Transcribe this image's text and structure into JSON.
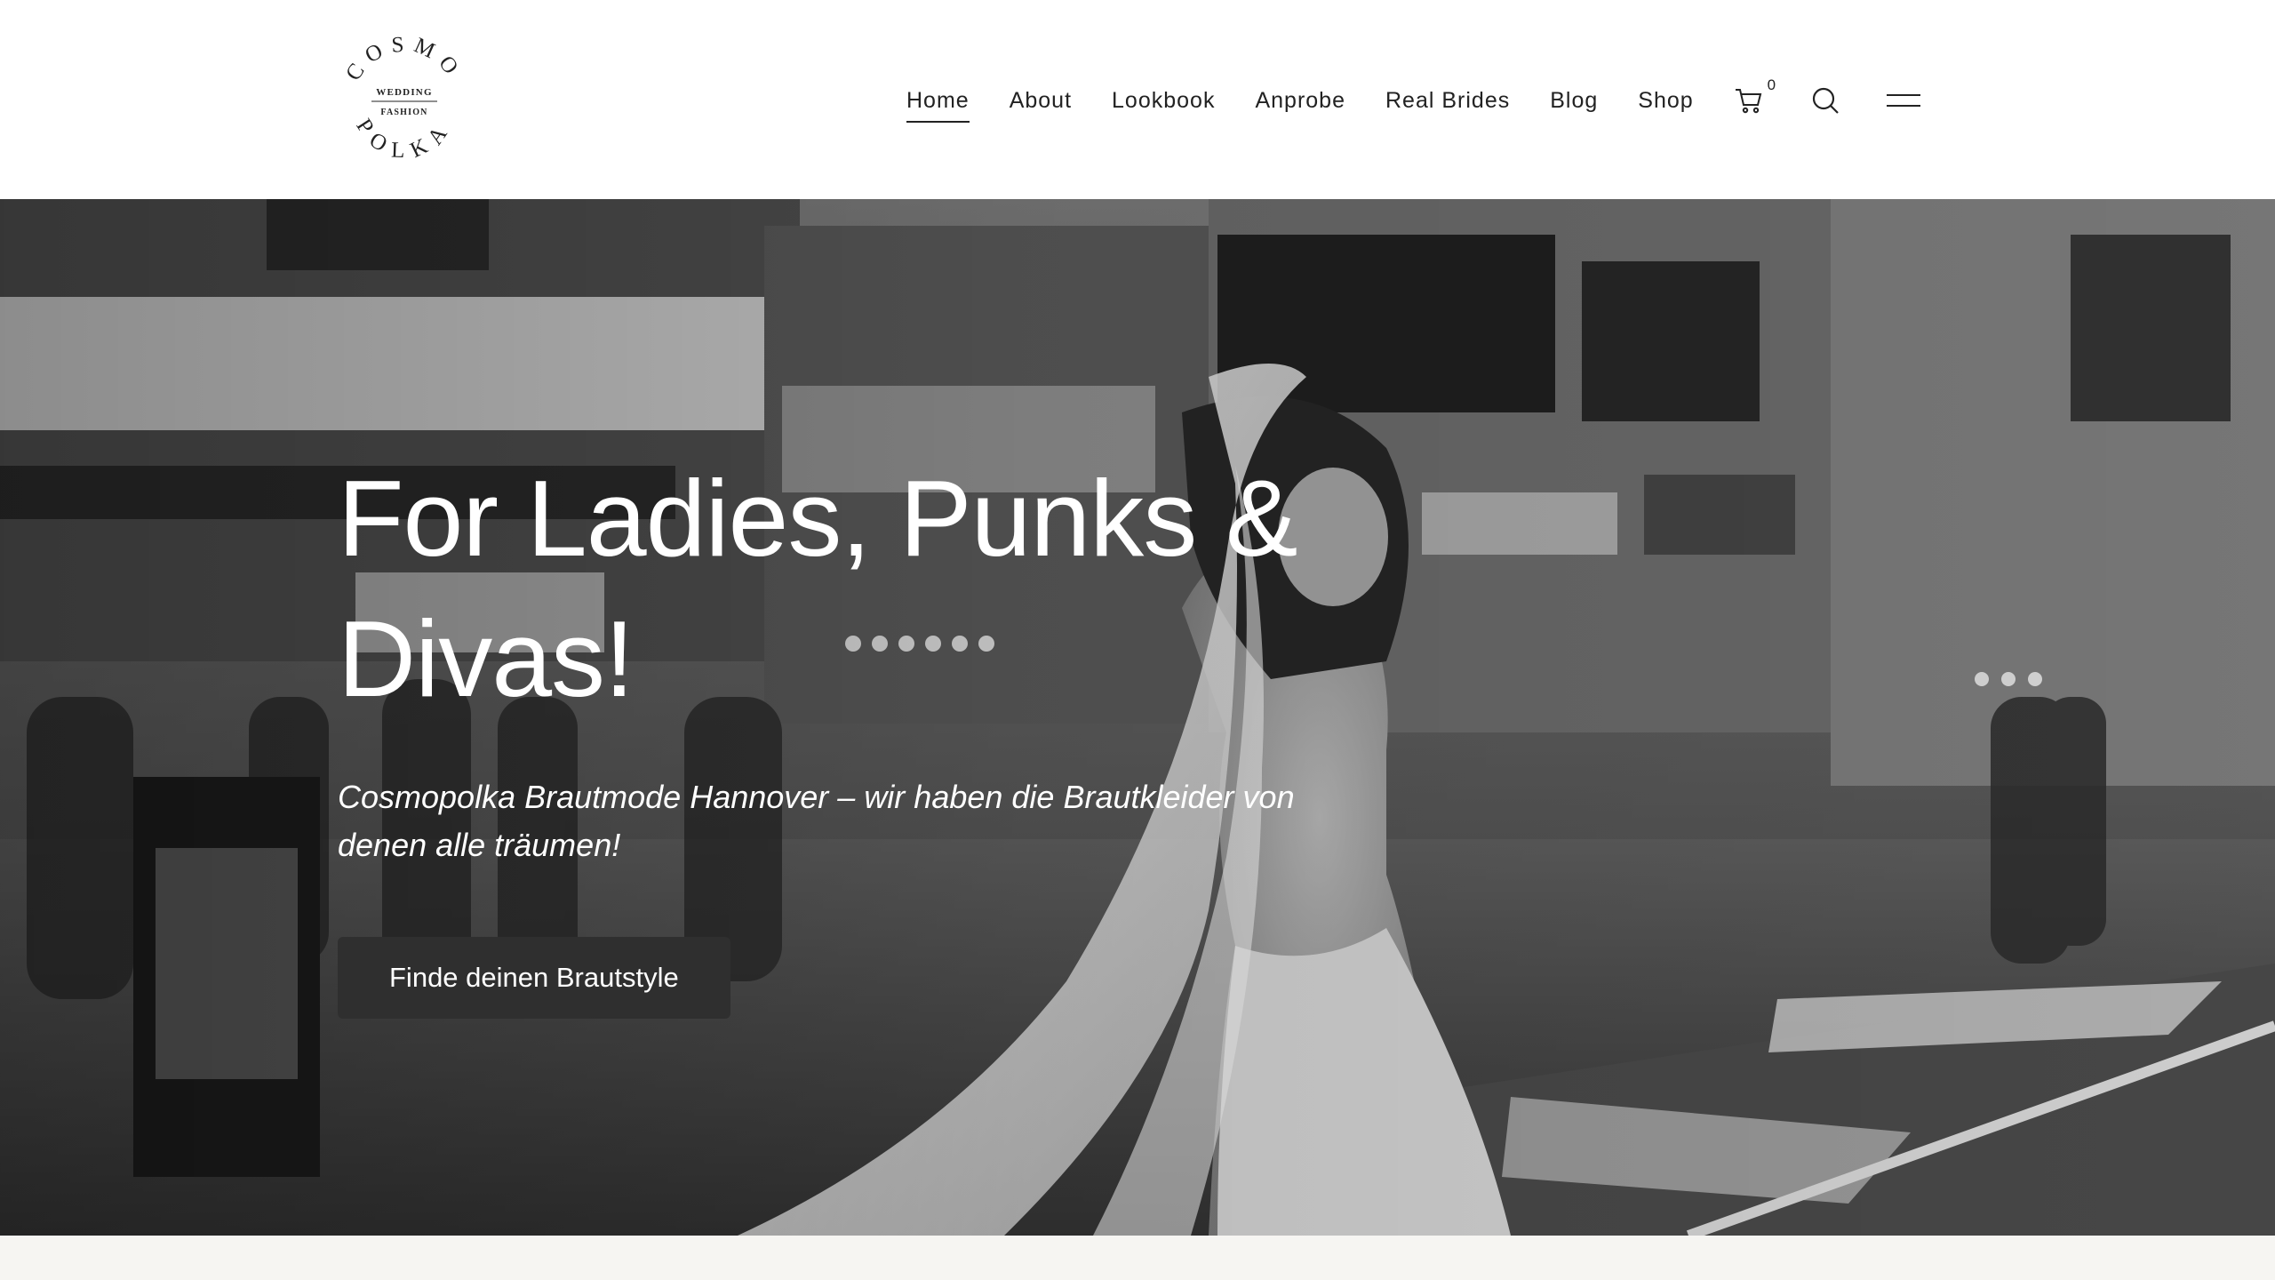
{
  "brand": {
    "logo_top_text": "COSMO",
    "logo_line1": "WEDDING",
    "logo_line2": "FASHION",
    "logo_bottom_text": "POLKA"
  },
  "nav": {
    "items": [
      {
        "label": "Home",
        "active": true
      },
      {
        "label": "About",
        "active": false
      },
      {
        "label": "Lookbook",
        "active": false
      },
      {
        "label": "Anprobe",
        "active": false
      },
      {
        "label": "Real Brides",
        "active": false
      },
      {
        "label": "Blog",
        "active": false
      },
      {
        "label": "Shop",
        "active": false
      }
    ],
    "cart_count": "0",
    "icons": [
      "cart-icon",
      "search-icon",
      "menu-icon"
    ]
  },
  "hero": {
    "title": "For Ladies, Punks & Divas!",
    "subtitle": "Cosmopolka Brautmode Hannover – wir haben die Brautkleider von denen alle träumen!",
    "button_label": "Finde deinen Brautstyle"
  },
  "colors": {
    "button_bg": "#2f2f2f",
    "text_dark": "#222222",
    "strip_bg": "#f6f5f2"
  }
}
